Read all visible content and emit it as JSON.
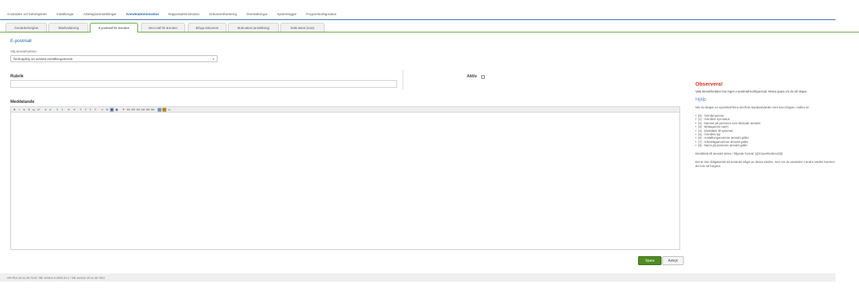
{
  "topnav": {
    "items": [
      {
        "label": "Användare och behörigheter",
        "active": false
      },
      {
        "label": "Inställningar",
        "active": false
      },
      {
        "label": "Arbetsgivarinställningar",
        "active": false
      },
      {
        "label": "Ärendeadministration",
        "active": true
      },
      {
        "label": "Rapportadministration",
        "active": false
      },
      {
        "label": "Dokumenthantering",
        "active": false
      },
      {
        "label": "Översättningar",
        "active": false
      },
      {
        "label": "Systemloggar",
        "active": false
      },
      {
        "label": "Programkonfiguration",
        "active": false
      }
    ]
  },
  "tabs": [
    {
      "label": "Ärendebehörighet",
      "active": false
    },
    {
      "label": "Tabellvalidering",
      "active": false
    },
    {
      "label": "E-postmall för ärenden",
      "active": true
    },
    {
      "label": "Sms-mall för ärenden",
      "active": false
    },
    {
      "label": "Bifoga dokument",
      "active": false
    },
    {
      "label": "Multi-attest (anställning)",
      "active": false
    },
    {
      "label": "Multi-attest (resa)",
      "active": false
    }
  ],
  "form": {
    "section_title": "E-postmall",
    "function_label": "Välj ärendefunktion:",
    "function_value": "Återkoppling om avslutat anställningsärende",
    "subject_label": "Rubrik",
    "active_label": "Aktiv",
    "message_label": "Meddelande",
    "save_label": "Spara",
    "cancel_label": "Avbryt"
  },
  "toolbar_buttons": [
    {
      "name": "bold-icon",
      "glyph": "B"
    },
    {
      "name": "italic-icon",
      "glyph": "I"
    },
    {
      "name": "underline-icon",
      "glyph": "U"
    },
    {
      "name": "strikethrough-icon",
      "glyph": "S"
    },
    {
      "name": "subscript-icon",
      "glyph": "x₂"
    },
    {
      "name": "superscript-icon",
      "glyph": "x²"
    },
    {
      "name": "text-color-icon",
      "glyph": "A"
    },
    {
      "name": "background-color-icon",
      "glyph": "A"
    },
    {
      "name": "numbered-list-icon",
      "glyph": "≡"
    },
    {
      "name": "bulleted-list-icon",
      "glyph": "≡"
    },
    {
      "name": "outdent-icon",
      "glyph": "⇤"
    },
    {
      "name": "indent-icon",
      "glyph": "⇥"
    },
    {
      "name": "align-left-icon",
      "glyph": "≡"
    },
    {
      "name": "align-center-icon",
      "glyph": "≡"
    },
    {
      "name": "align-right-icon",
      "glyph": "≡"
    },
    {
      "name": "align-justify-icon",
      "glyph": "≡"
    },
    {
      "name": "link-icon",
      "glyph": "∞"
    },
    {
      "name": "unlink-icon",
      "glyph": "⊘"
    },
    {
      "name": "image-icon",
      "glyph": "▣"
    },
    {
      "name": "table-icon",
      "glyph": "▦"
    },
    {
      "name": "paragraph-icon",
      "glyph": "P"
    },
    {
      "name": "heading-1-icon",
      "glyph": "H1"
    },
    {
      "name": "heading-2-icon",
      "glyph": "H2"
    },
    {
      "name": "heading-3-icon",
      "glyph": "H3"
    },
    {
      "name": "heading-4-icon",
      "glyph": "H4"
    },
    {
      "name": "heading-5-icon",
      "glyph": "H5"
    },
    {
      "name": "heading-6-icon",
      "glyph": "H6"
    },
    {
      "name": "paste-icon",
      "glyph": "▤"
    },
    {
      "name": "paste-word-icon",
      "glyph": "W"
    },
    {
      "name": "source-icon",
      "glyph": "▭"
    }
  ],
  "side": {
    "notice_title": "Observera!",
    "notice_text": "Vald ärendefunktion har ingen e-postmall konfigurerad. Klicka spara om du vill skapa",
    "help_title": "Hjälp",
    "help_intro": "När du skapar en epostmall finns det flera standardvärden som kan infogas i mallen är:",
    "placeholders": [
      "{0} - Ärendenummer",
      "{1} - Ärendets nya status",
      "{2} - Namnet på personen som skickade ärendet",
      "{3} - Mottagarens namn",
      "{4} - Direktlänk till systemet",
      "{5} - Ärendets typ",
      "{6} - Anställningsnummer ärendet gäller",
      "{7} - Arbetstagarnummer ärendet gäller",
      "{8} - Namn på personen ärendet gäller"
    ],
    "direct_link_text": "Direktlänk till ärendet skrivs i följande format: {4}/Case/Redirect/{0}",
    "footnote": "Det är inte obligatoriskt att använda något av dessa värden, men om du använder n andra värden kommer det inte att fungera."
  },
  "footer": {
    "version": "HR-Plus 20.11.25.7242 / BE version 8.2020.20.1 / DB version 20.11.25.7242"
  },
  "colors": {
    "accent_blue": "#1f5fa8",
    "tab_green": "#5aa02c",
    "save_green": "#4e8c23",
    "notice_red": "#d62c1c"
  }
}
